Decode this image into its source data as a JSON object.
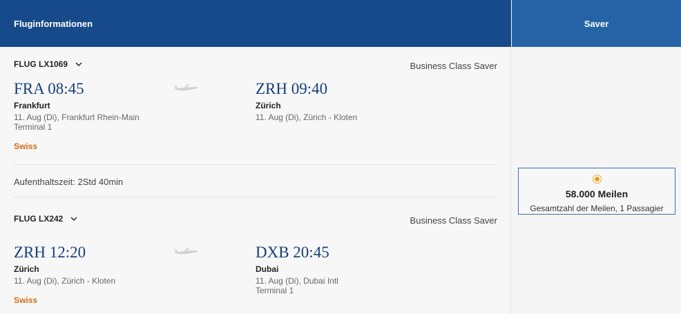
{
  "header": {
    "title": "Fluginformationen",
    "fare_title": "Saver"
  },
  "flights": [
    {
      "flight_label": "FLUG LX1069",
      "cabin": "Business Class Saver",
      "departure": {
        "time": "FRA 08:45",
        "city": "Frankfurt",
        "date_airport": "11. Aug (Di), Frankfurt Rhein-Main",
        "terminal": "Terminal 1"
      },
      "arrival": {
        "time": "ZRH 09:40",
        "city": "Zürich",
        "date_airport": "11. Aug (Di), Zürich - Kloten"
      },
      "airline": "Swiss"
    },
    {
      "flight_label": "FLUG LX242",
      "cabin": "Business Class Saver",
      "departure": {
        "time": "ZRH 12:20",
        "city": "Zürich",
        "date_airport": "11. Aug (Di), Zürich - Kloten"
      },
      "arrival": {
        "time": "DXB 20:45",
        "city": "Dubai",
        "date_airport": "11. Aug (Di), Dubai Intl",
        "terminal": "Terminal 1"
      },
      "airline": "Swiss"
    }
  ],
  "layover": "Aufenthaltszeit: 2Std 40min",
  "fare": {
    "miles": "58.000 Meilen",
    "subtitle": "Gesamtzahl der Meilen, 1 Passagier",
    "selected": true
  },
  "colors": {
    "header_dark": "#174a8a",
    "header_light": "#2663a6",
    "time_blue": "#163f7a",
    "airline_orange": "#d46a17",
    "radio_orange": "#f29a1f"
  }
}
